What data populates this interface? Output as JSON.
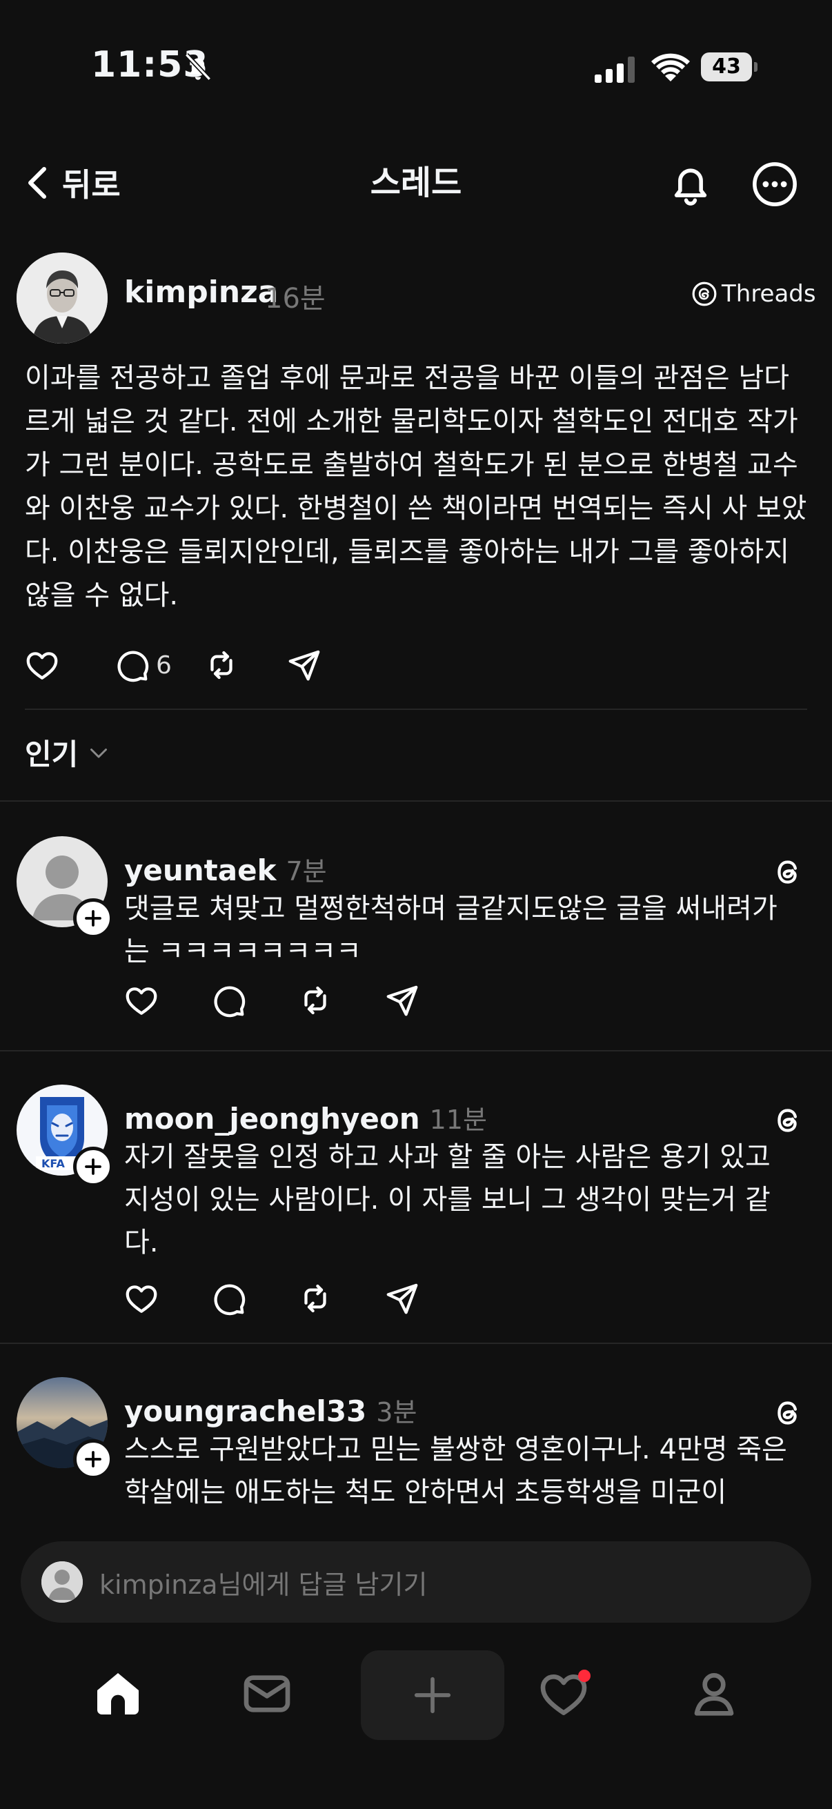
{
  "status": {
    "time": "11:53",
    "battery": "43"
  },
  "nav": {
    "back_label": "뒤로",
    "title": "스레드"
  },
  "post": {
    "username": "kimpinza",
    "time": "16분",
    "threads_badge": "Threads",
    "text": "이과를 전공하고 졸업 후에 문과로 전공을 바꾼 이들의 관점은 남다르게 넓은 것 같다. 전에 소개한 물리학도이자 철학도인 전대호 작가가 그런 분이다. 공학도로 출발하여 철학도가 된 분으로 한병철 교수와 이찬웅 교수가 있다. 한병철이 쓴 책이라면 번역되는 즉시 사 보았다. 이찬웅은 들뢰지안인데, 들뢰즈를 좋아하는 내가 그를 좋아하지 않을 수 없다.",
    "reply_count": "6"
  },
  "sort": {
    "label": "인기"
  },
  "replies": [
    {
      "username": "yeuntaek",
      "time": "7분",
      "text": "댓글로 쳐맞고 멀쩡한척하며 글같지도않은 글을 써내려가는 ㅋㅋㅋㅋㅋㅋㅋㅋ"
    },
    {
      "username": "moon_jeonghyeon",
      "time": "11분",
      "text": "자기 잘못을 인정 하고 사과 할 줄 아는 사람은 용기 있고 지성이 있는 사람이다. 이 자를 보니 그 생각이 맞는거 같다."
    },
    {
      "username": "youngrachel33",
      "time": "3분",
      "text": "스스로 구원받았다고 믿는 불쌍한 영혼이구나. 4만명 죽은 학살에는 애도하는 척도 안하면서 초등학생을 미군이"
    }
  ],
  "reply_input": {
    "placeholder": "kimpinza님에게 답글 남기기"
  },
  "icons": {
    "back": "chevron-left-icon",
    "bell": "bell-icon",
    "more": "more-icon",
    "like": "heart-icon",
    "comment": "comment-icon",
    "repost": "repost-icon",
    "share": "send-icon",
    "home": "home-icon",
    "inbox": "inbox-icon",
    "create": "plus-icon",
    "activity": "heart-icon",
    "profile": "profile-icon"
  },
  "colors": {
    "background": "#101010",
    "text": "#f3f5f7",
    "secondary": "#777777",
    "notification_dot": "#ff2a3a"
  }
}
